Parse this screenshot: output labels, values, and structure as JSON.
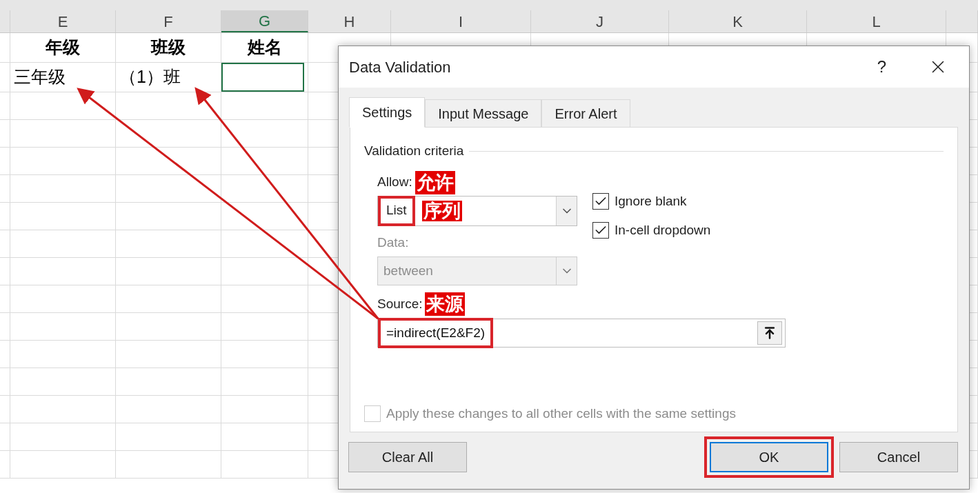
{
  "sheet": {
    "columns": [
      {
        "label": "E",
        "selected": false
      },
      {
        "label": "F",
        "selected": false
      },
      {
        "label": "G",
        "selected": true
      },
      {
        "label": "H",
        "selected": false
      },
      {
        "label": "I",
        "selected": false
      },
      {
        "label": "J",
        "selected": false
      },
      {
        "label": "K",
        "selected": false
      },
      {
        "label": "L",
        "selected": false
      }
    ],
    "header_row": [
      "年级",
      "班级",
      "姓名"
    ],
    "data_row": [
      "三年级",
      "（1）班"
    ]
  },
  "dialog": {
    "title": "Data Validation",
    "help": "?",
    "tabs": [
      {
        "label": "Settings",
        "selected": true
      },
      {
        "label": "Input Message",
        "selected": false
      },
      {
        "label": "Error Alert",
        "selected": false
      }
    ],
    "section": "Validation criteria",
    "allow": {
      "label": "Allow:",
      "value": "List",
      "highlighted": true,
      "annotation": "允许",
      "value_annotation": "序列"
    },
    "data": {
      "label": "Data:",
      "value": "between",
      "disabled": true
    },
    "source": {
      "label": "Source:",
      "value": "=indirect(E2&F2)",
      "highlighted": true,
      "annotation": "来源"
    },
    "checkboxes": [
      {
        "label": "Ignore blank",
        "checked": true
      },
      {
        "label": "In-cell dropdown",
        "checked": true
      }
    ],
    "apply_all": {
      "label": "Apply these changes to all other cells with the same settings",
      "checked": false,
      "disabled": true
    },
    "buttons": [
      {
        "label": "Clear All",
        "kind": "plain",
        "highlighted": false
      },
      {
        "label": "OK",
        "kind": "default",
        "highlighted": true
      },
      {
        "label": "Cancel",
        "kind": "plain",
        "highlighted": false
      }
    ]
  }
}
